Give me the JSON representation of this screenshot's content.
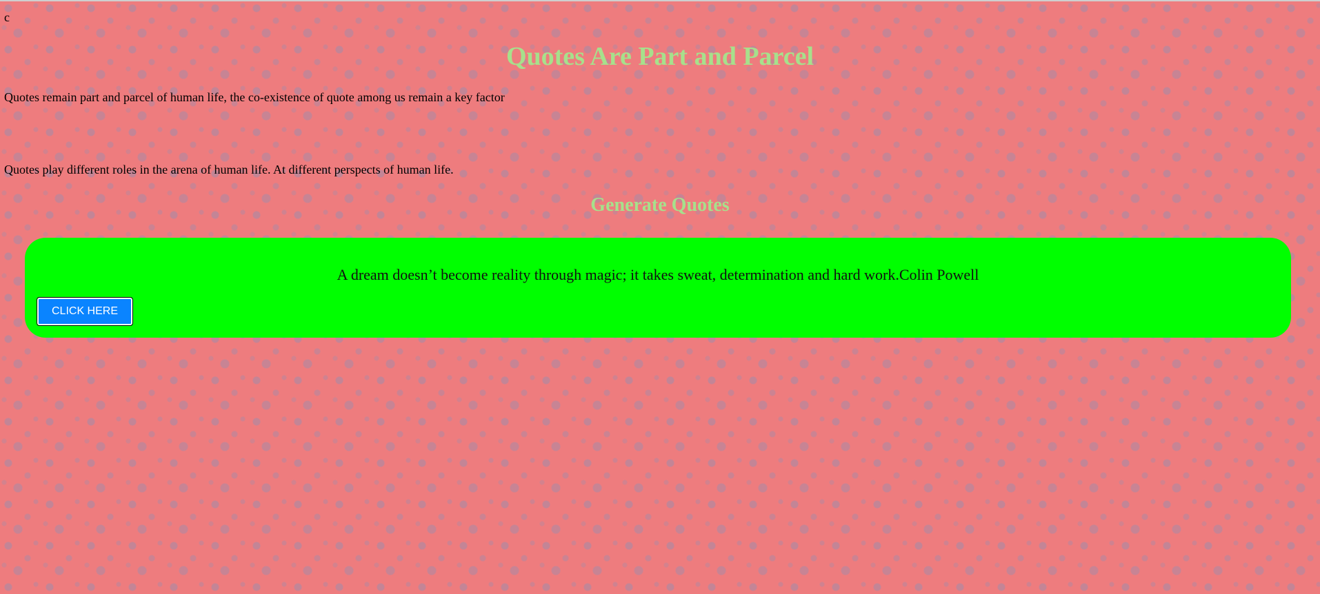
{
  "page": {
    "stray_text": "c",
    "title": "Quotes Are Part and Parcel",
    "paragraphs": [
      "Quotes remain part and parcel of human life, the co-existence of quote among us remain a key factor",
      "Quotes play different roles in the arena of human life. At different perspects of human life."
    ],
    "section_title": "Generate Quotes"
  },
  "quote_card": {
    "quote": "A dream doesn’t become reality through magic; it takes sweat, determination and hard work.Colin Powell",
    "button_label": "CLICK HERE"
  },
  "colors": {
    "background": "#ee7c7e",
    "heading": "#a7e08c",
    "card": "#00ff00",
    "button": "#0a84ff"
  }
}
